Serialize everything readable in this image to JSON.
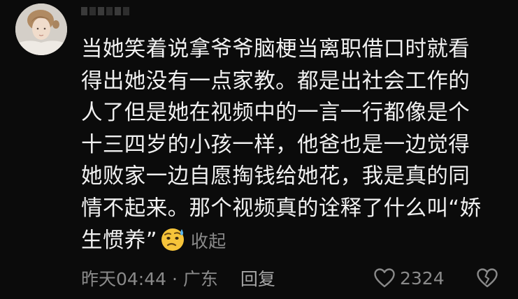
{
  "comment": {
    "lines": [
      "当她笑着说拿爷爷脑梗当离职借口时就看",
      "得出她没有一点家教。都是出社会工作的",
      "人了但是她在视频中的一言一行都像是个",
      "十三四岁的小孩一样，他爸也是一边觉得",
      "她败家一边自愿掏钱给她花，我是真的同",
      "情不起来。那个视频真的诠释了什么叫“娇",
      "生惯养”"
    ],
    "emoji_icon": "sweat-emoji",
    "collapse_label": "收起"
  },
  "meta": {
    "time_location": "昨天04:44 · 广东",
    "reply_label": "回复",
    "like_count": "2324",
    "like_icon": "heart-outline-icon",
    "dislike_icon": "broken-heart-icon"
  },
  "colors": {
    "background": "#0b0b0b",
    "text": "#f0f0f0",
    "secondary": "#8a8a8a"
  }
}
